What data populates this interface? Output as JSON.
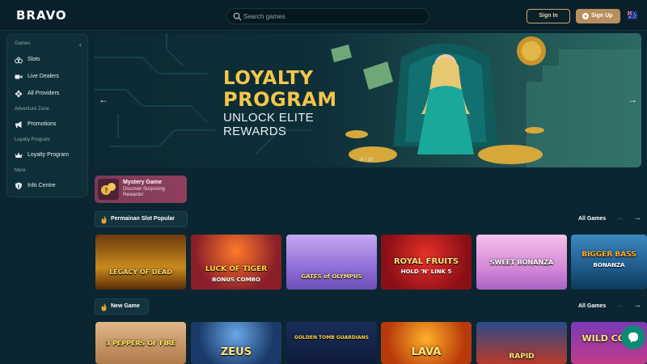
{
  "header": {
    "logo": "BRAVO",
    "search_placeholder": "Search games",
    "signin_label": "Sign In",
    "signup_label": "Sign Up",
    "accent_gold": "#c9a96e",
    "signup_bg": "#b98e5e"
  },
  "sidebar": {
    "games_section": "Games",
    "collapse_icon": "chevron-left-icon",
    "adventure_section": "Adventure Zone",
    "loyalty_section": "Loyalty Program",
    "more_section": "More",
    "items": [
      {
        "label": "Slots",
        "icon": "slot-machine-icon"
      },
      {
        "label": "Live Dealers",
        "icon": "video-camera-icon"
      },
      {
        "label": "All Providers",
        "icon": "grid-diamond-icon"
      },
      {
        "label": "Promotions",
        "icon": "megaphone-icon"
      },
      {
        "label": "Loyalty Program",
        "icon": "crown-icon"
      },
      {
        "label": "Info Centre",
        "icon": "info-shield-icon"
      }
    ]
  },
  "hero": {
    "title_line1": "LOYALTY",
    "title_line2": "PROGRAM",
    "sub_line1": "UNLOCK ELITE",
    "sub_line2": "REWARDS",
    "counter": "8 / 10",
    "title_color": "#f3c64a"
  },
  "mystery": {
    "title": "Mystery Game",
    "desc": "Discover Surprising Rewards!"
  },
  "sections": [
    {
      "title": "Permainan Slot Popular",
      "all_label": "All Games",
      "tiles": [
        {
          "name": "LEGACY OF DEAD",
          "sub": ""
        },
        {
          "name": "LUCK OF TIGER",
          "sub": "BONUS COMBO"
        },
        {
          "name": "GATES of OLYMPUS",
          "sub": ""
        },
        {
          "name": "ROYAL FRUITS",
          "sub": "HOLD 'N' LINK 5"
        },
        {
          "name": "SWEET BONANZA",
          "sub": ""
        },
        {
          "name": "BIGGER BASS",
          "sub": "BONANZA"
        }
      ]
    },
    {
      "title": "New Game",
      "all_label": "All Games",
      "tiles": [
        {
          "name": "3 PEPPERS OF FIRE",
          "sub": ""
        },
        {
          "name": "ZEUS",
          "sub": ""
        },
        {
          "name": "GOLDEN TOMB GUARDIANS",
          "sub": ""
        },
        {
          "name": "LAVA",
          "sub": ""
        },
        {
          "name": "RAPID",
          "sub": ""
        },
        {
          "name": "WILD COIN",
          "sub": ""
        }
      ]
    }
  ]
}
